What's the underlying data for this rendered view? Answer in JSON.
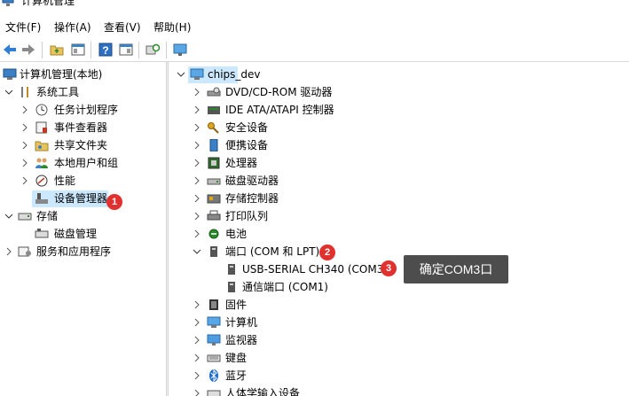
{
  "window": {
    "title": "计算机管理"
  },
  "menu": {
    "file": "文件(F)",
    "action": "操作(A)",
    "view": "查看(V)",
    "help": "帮助(H)"
  },
  "left_tree": {
    "root": "计算机管理(本地)",
    "system_tools": "系统工具",
    "task_scheduler": "任务计划程序",
    "event_viewer": "事件查看器",
    "shared_folders": "共享文件夹",
    "local_users": "本地用户和组",
    "performance": "性能",
    "device_manager": "设备管理器",
    "storage": "存储",
    "disk_management": "磁盘管理",
    "services_apps": "服务和应用程序"
  },
  "right_tree": {
    "root": "chips_dev",
    "categories": {
      "dvd": "DVD/CD-ROM 驱动器",
      "ide": "IDE ATA/ATAPI 控制器",
      "security": "安全设备",
      "portable": "便携设备",
      "processor": "处理器",
      "disk": "磁盘驱动器",
      "storage_ctrl": "存储控制器",
      "print_queue": "打印队列",
      "battery": "电池",
      "ports": "端口 (COM 和 LPT)",
      "port_usb_serial": "USB-SERIAL CH340 (COM3)",
      "port_comm": "通信端口 (COM1)",
      "firmware": "固件",
      "computer": "计算机",
      "monitor": "监视器",
      "keyboard": "键盘",
      "bluetooth": "蓝牙",
      "hid": "人体学输入设备"
    }
  },
  "annotations": {
    "badge1": "1",
    "badge2": "2",
    "badge3": "3",
    "tooltip": "确定COM3口"
  },
  "colors": {
    "selection": "#cce8ff",
    "badge": "#e0312f",
    "tooltip_bg": "#4d4d4d"
  }
}
